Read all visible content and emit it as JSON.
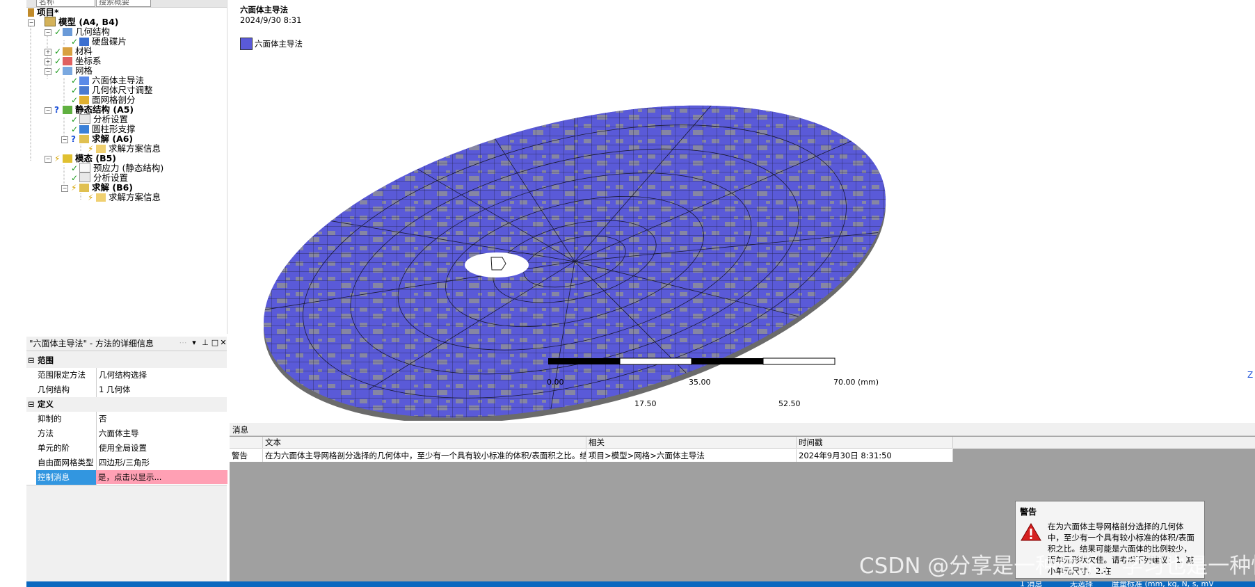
{
  "tree": {
    "filter_label": "名称",
    "search_placeholder": "搜索概要",
    "items": [
      {
        "label": "项目*"
      },
      {
        "label": "模型 (A4, B4)"
      },
      {
        "label": "几何结构"
      },
      {
        "label": "硬盘碟片"
      },
      {
        "label": "材料"
      },
      {
        "label": "坐标系"
      },
      {
        "label": "网格"
      },
      {
        "label": "六面体主导法"
      },
      {
        "label": "几何体尺寸调整"
      },
      {
        "label": "面网格剖分"
      },
      {
        "label": "静态结构 (A5)"
      },
      {
        "label": "分析设置"
      },
      {
        "label": "圆柱形支撑"
      },
      {
        "label": "求解 (A6)"
      },
      {
        "label": "求解方案信息"
      },
      {
        "label": "模态 (B5)"
      },
      {
        "label": "预应力 (静态结构)"
      },
      {
        "label": "分析设置"
      },
      {
        "label": "求解 (B6)"
      },
      {
        "label": "求解方案信息"
      }
    ]
  },
  "details": {
    "title": "\"六面体主导法\" - 方法的详细信息",
    "rows": [
      {
        "k": "范围",
        "v": ""
      },
      {
        "k": "范围限定方法",
        "v": "几何结构选择"
      },
      {
        "k": "几何结构",
        "v": "1 几何体"
      },
      {
        "k": "定义",
        "v": ""
      },
      {
        "k": "抑制的",
        "v": "否"
      },
      {
        "k": "方法",
        "v": "六面体主导"
      },
      {
        "k": "单元的阶",
        "v": "使用全局设置"
      },
      {
        "k": "自由面网格类型",
        "v": "四边形/三角形"
      },
      {
        "k": "控制消息",
        "v": "是，点击以显示..."
      }
    ]
  },
  "view": {
    "title": "六面体主导法",
    "date": "2024/9/30 8:31",
    "legend": "六面体主导法",
    "legend_color": "#5a5ad8",
    "scale": {
      "top": [
        "0.00",
        "35.00",
        "70.00 (mm)"
      ],
      "bottom": [
        "17.50",
        "52.50"
      ]
    },
    "axis": "Z"
  },
  "messages": {
    "panel_label": "消息",
    "headers": [
      "文本",
      "相关",
      "时间戳"
    ],
    "row": {
      "type": "警告",
      "text": "在为六面体主导网格剖分选择的几何体中，至少有一个具有较小标准的体积/表面积之比。结果",
      "related": "项目>模型>网格>六面体主导法",
      "time": "2024年9月30日 8:31:50"
    }
  },
  "popup": {
    "title": "警告",
    "body": "在为六面体主导网格剖分选择的几何体中，至少有一个具有较小标准的体积/表面积之比。结果可能是六面体的比例较少，而单元形状欠佳。请考虑下列建议：1. 减小单元尺寸。2.在"
  },
  "watermark": "CSDN @分享是一种快乐，学习也是一种快乐",
  "status": {
    "messages": "1 消息",
    "selection": "无选择",
    "units": "度量标准 (mm, kg, N, s, mV"
  }
}
